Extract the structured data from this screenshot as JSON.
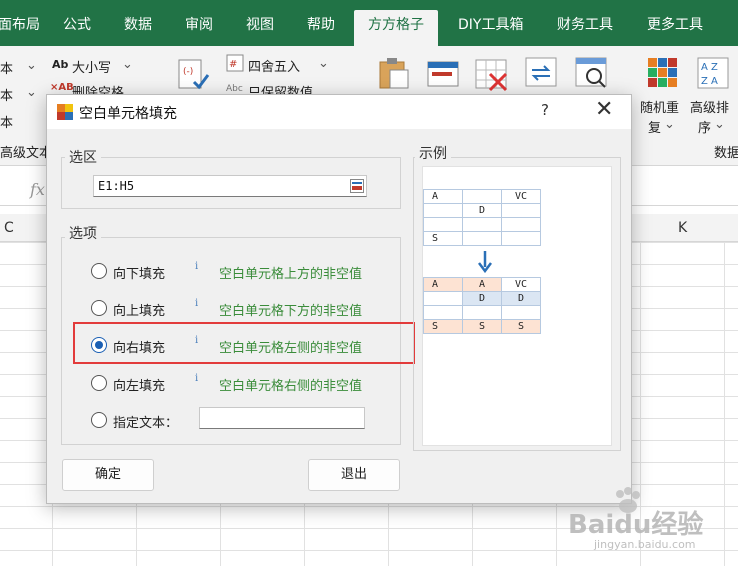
{
  "ribbon": {
    "tabs": [
      "面布局",
      "公式",
      "数据",
      "审阅",
      "视图",
      "帮助",
      "方方格子",
      "DIY工具箱",
      "财务工具",
      "更多工具"
    ],
    "active_tab": "方方格子",
    "left_items": [
      "本",
      "本",
      "本"
    ],
    "left_group_label": "高级文本",
    "case_label": "大小写",
    "delete_label": "删除空格",
    "round_label": "四舍五入",
    "keep_value_label": "只保留数值",
    "random_label_1": "随机重",
    "random_label_2": "复",
    "sort_label_1": "高级排",
    "sort_label_2": "序",
    "data_group_label": "数据"
  },
  "formula_bar": {
    "fx": "fx"
  },
  "columns": [
    "C",
    "K"
  ],
  "dialog": {
    "title": "空白单元格填充",
    "help": "?",
    "close": "✕",
    "selection_group": "选区",
    "selection_value": "E1:H5",
    "options_group": "选项",
    "options": [
      {
        "label": "向下填充",
        "desc": "空白单元格上方的非空值",
        "checked": false
      },
      {
        "label": "向上填充",
        "desc": "空白单元格下方的非空值",
        "checked": false
      },
      {
        "label": "向右填充",
        "desc": "空白单元格左侧的非空值",
        "checked": true
      },
      {
        "label": "向左填充",
        "desc": "空白单元格右侧的非空值",
        "checked": false
      }
    ],
    "custom_text_label": "指定文本：",
    "custom_text_value": "",
    "example_group": "示例",
    "info_glyph": "i",
    "ok_button": "确定",
    "exit_button": "退出"
  },
  "example": {
    "before": [
      [
        "A",
        "",
        "VC"
      ],
      [
        "",
        "D",
        ""
      ],
      [
        "",
        "",
        ""
      ],
      [
        "S",
        "",
        ""
      ]
    ],
    "after": [
      [
        "A",
        "A",
        "VC"
      ],
      [
        "",
        "D",
        "D"
      ],
      [
        "",
        "",
        ""
      ],
      [
        "S",
        "S",
        "S"
      ]
    ]
  },
  "watermark": {
    "brand": "Baidu经验",
    "url": "jingyan.baidu.com"
  },
  "colors": {
    "accent_green": "#217346",
    "highlight_red": "#e23b3b",
    "desc_green": "#3a8c3a"
  }
}
